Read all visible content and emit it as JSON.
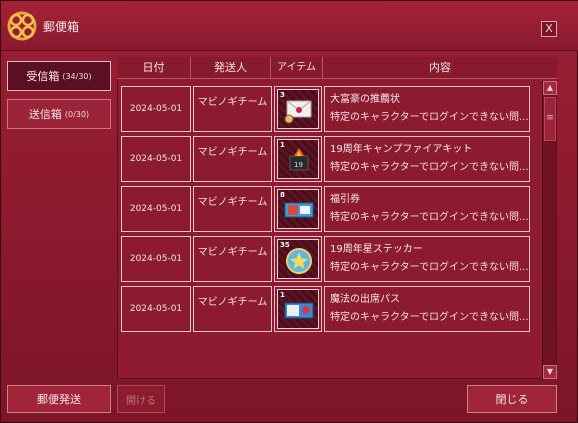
{
  "window": {
    "title": "郵便箱",
    "close_label": "X"
  },
  "sidebar": {
    "inbox_label": "受信箱",
    "inbox_count": "(34/30)",
    "outbox_label": "送信箱",
    "outbox_count": "(0/30)"
  },
  "columns": {
    "date": "日付",
    "sender": "発送人",
    "item": "アイテム",
    "content": "内容"
  },
  "rows": [
    {
      "date": "2024-05-01",
      "sender": "マビノギチーム",
      "qty": "3",
      "icon": "letter-icon",
      "name": "大富豪の推薦状",
      "desc": "特定のキャラクターでログインできない問..."
    },
    {
      "date": "2024-05-01",
      "sender": "マビノギチーム",
      "qty": "1",
      "icon": "camp-kit-icon",
      "name": "19周年キャンプファイアキット",
      "desc": "特定のキャラクターでログインできない問..."
    },
    {
      "date": "2024-05-01",
      "sender": "マビノギチーム",
      "qty": "8",
      "icon": "lottery-ticket-icon",
      "name": "福引券",
      "desc": "特定のキャラクターでログインできない問..."
    },
    {
      "date": "2024-05-01",
      "sender": "マビノギチーム",
      "qty": "35",
      "icon": "star-sticker-icon",
      "name": "19周年星ステッカー",
      "desc": "特定のキャラクターでログインできない問..."
    },
    {
      "date": "2024-05-01",
      "sender": "マビノギチーム",
      "qty": "1",
      "icon": "magic-pass-icon",
      "name": "魔法の出席パス",
      "desc": "特定のキャラクターでログインできない問..."
    }
  ],
  "buttons": {
    "send": "郵便発送",
    "open": "開ける",
    "close": "閉じる"
  },
  "scrollbar": {
    "up": "▲",
    "down": "▼",
    "thumb": "≡"
  }
}
